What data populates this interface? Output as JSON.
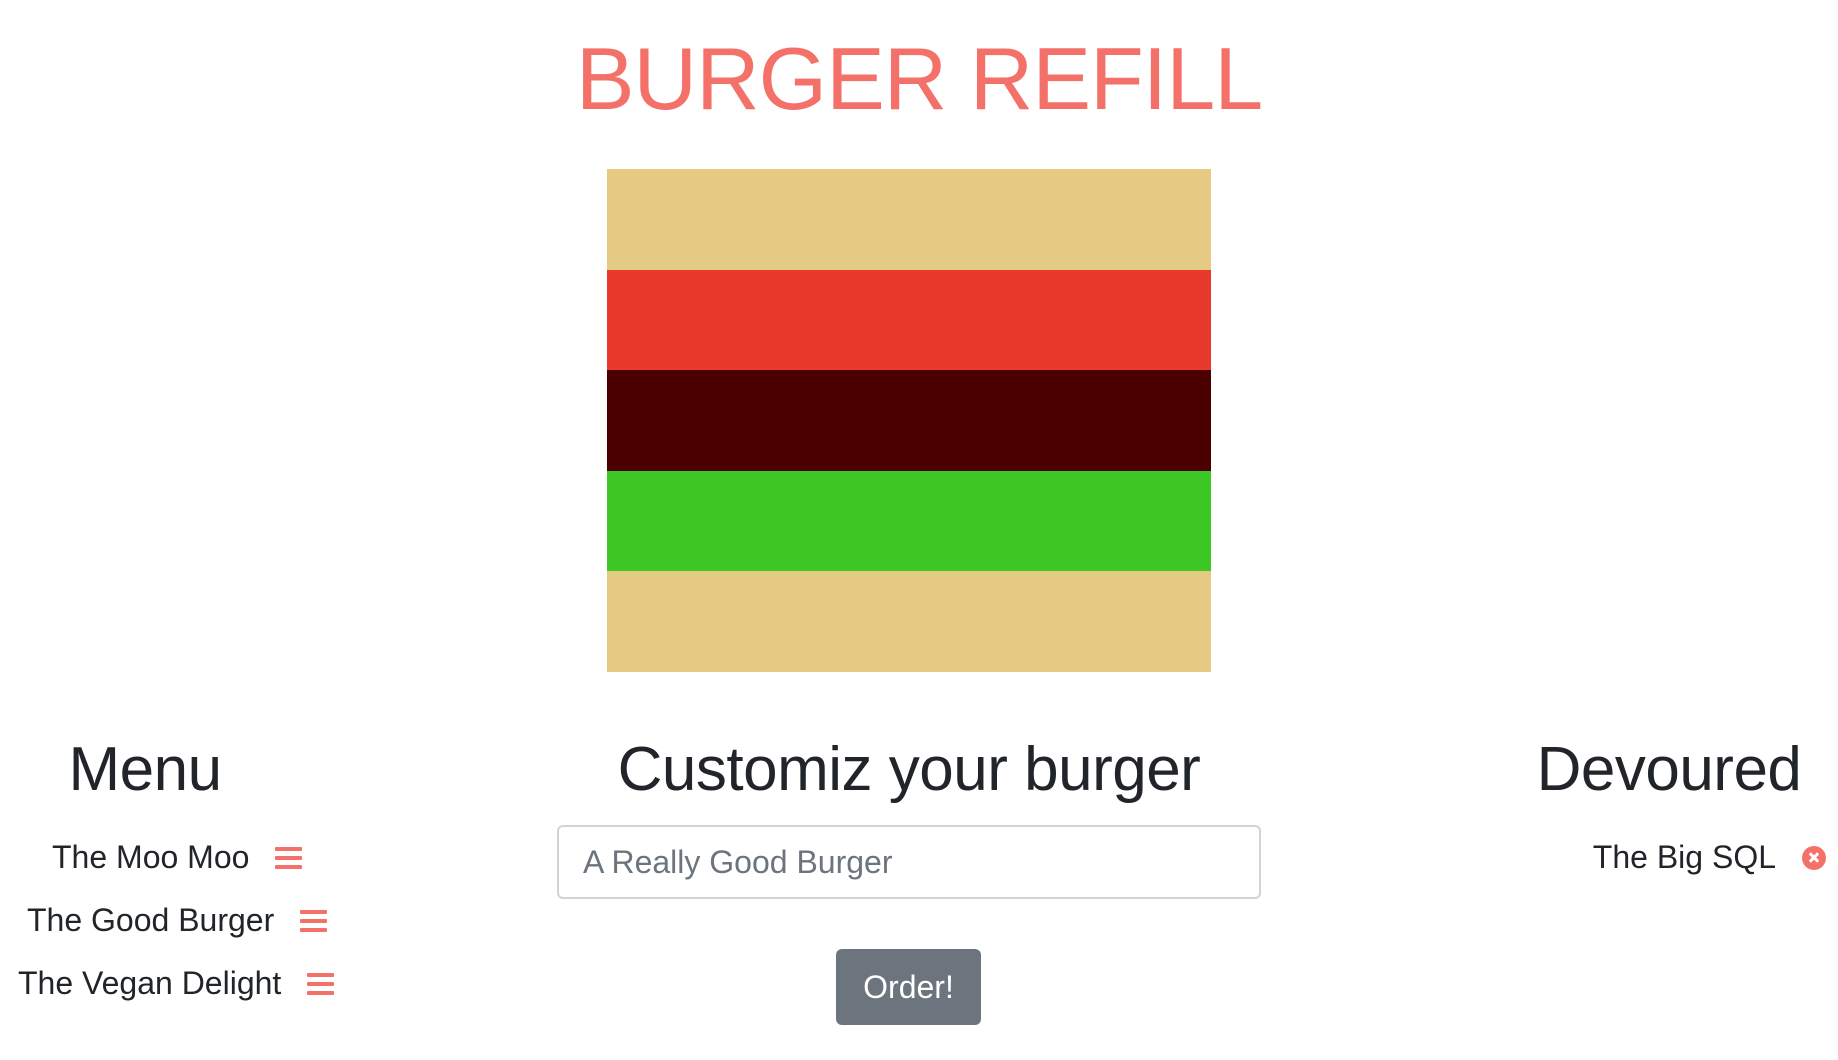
{
  "header": {
    "title": "BURGER REFILL"
  },
  "burger_image": {
    "layers": [
      "bun",
      "tomato",
      "patty",
      "lettuce",
      "bun"
    ],
    "colors": {
      "bun": "#e4ca82",
      "tomato": "#e8392d",
      "patty": "#4a0001",
      "lettuce": "#3cc724"
    }
  },
  "menu": {
    "heading": "Menu",
    "items": [
      {
        "label": "The Moo Moo",
        "icon": "bars-icon"
      },
      {
        "label": "The Good Burger",
        "icon": "bars-icon"
      },
      {
        "label": "The Vegan Delight",
        "icon": "bars-icon"
      }
    ]
  },
  "customize": {
    "heading": "Customiz your burger",
    "input_placeholder": "A Really Good Burger",
    "input_value": "",
    "order_label": "Order!"
  },
  "devoured": {
    "heading": "Devoured",
    "items": [
      {
        "label": "The Big SQL",
        "icon": "remove-circle-icon"
      }
    ]
  },
  "theme": {
    "accent": "#f4716a",
    "button_bg": "#6c757d",
    "text": "#212529"
  }
}
